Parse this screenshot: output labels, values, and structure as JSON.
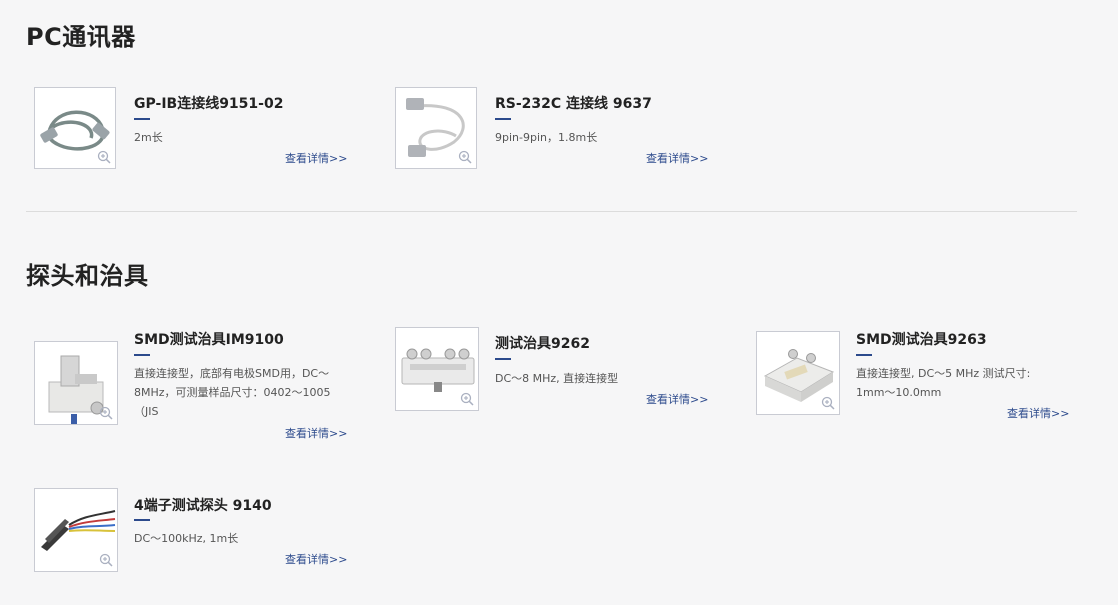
{
  "sections": [
    {
      "title": "PC通讯器",
      "products": [
        {
          "name": "GP-IB连接线9151-02",
          "desc": "2m长",
          "link": "查看详情>>",
          "icon": "zoom-in-icon"
        },
        {
          "name": "RS-232C 连接线 9637",
          "desc": "9pin-9pin，1.8m长",
          "link": "查看详情>>",
          "icon": "zoom-in-icon"
        }
      ]
    },
    {
      "title": "探头和治具",
      "products": [
        {
          "name": "SMD测试治具IM9100",
          "desc": "直接连接型，底部有电极SMD用，DC～8MHz，可测量样品尺寸：0402～1005（JIS",
          "link": "查看详情>>",
          "icon": "zoom-in-icon"
        },
        {
          "name": "测试治具9262",
          "desc": "DC～8 MHz, 直接连接型",
          "link": "查看详情>>",
          "icon": "zoom-in-icon"
        },
        {
          "name": "SMD测试治具9263",
          "desc": "直接连接型, DC～5 MHz 测试尺寸: 1mm～10.0mm",
          "link": "查看详情>>",
          "icon": "zoom-in-icon"
        },
        {
          "name": "4端子测试探头 9140",
          "desc": "DC～100kHz, 1m长",
          "link": "查看详情>>",
          "icon": "zoom-in-icon"
        }
      ]
    }
  ],
  "colors": {
    "accent": "#2c4a8c",
    "background": "#f6f6f7",
    "divider": "#dcdcdc"
  }
}
